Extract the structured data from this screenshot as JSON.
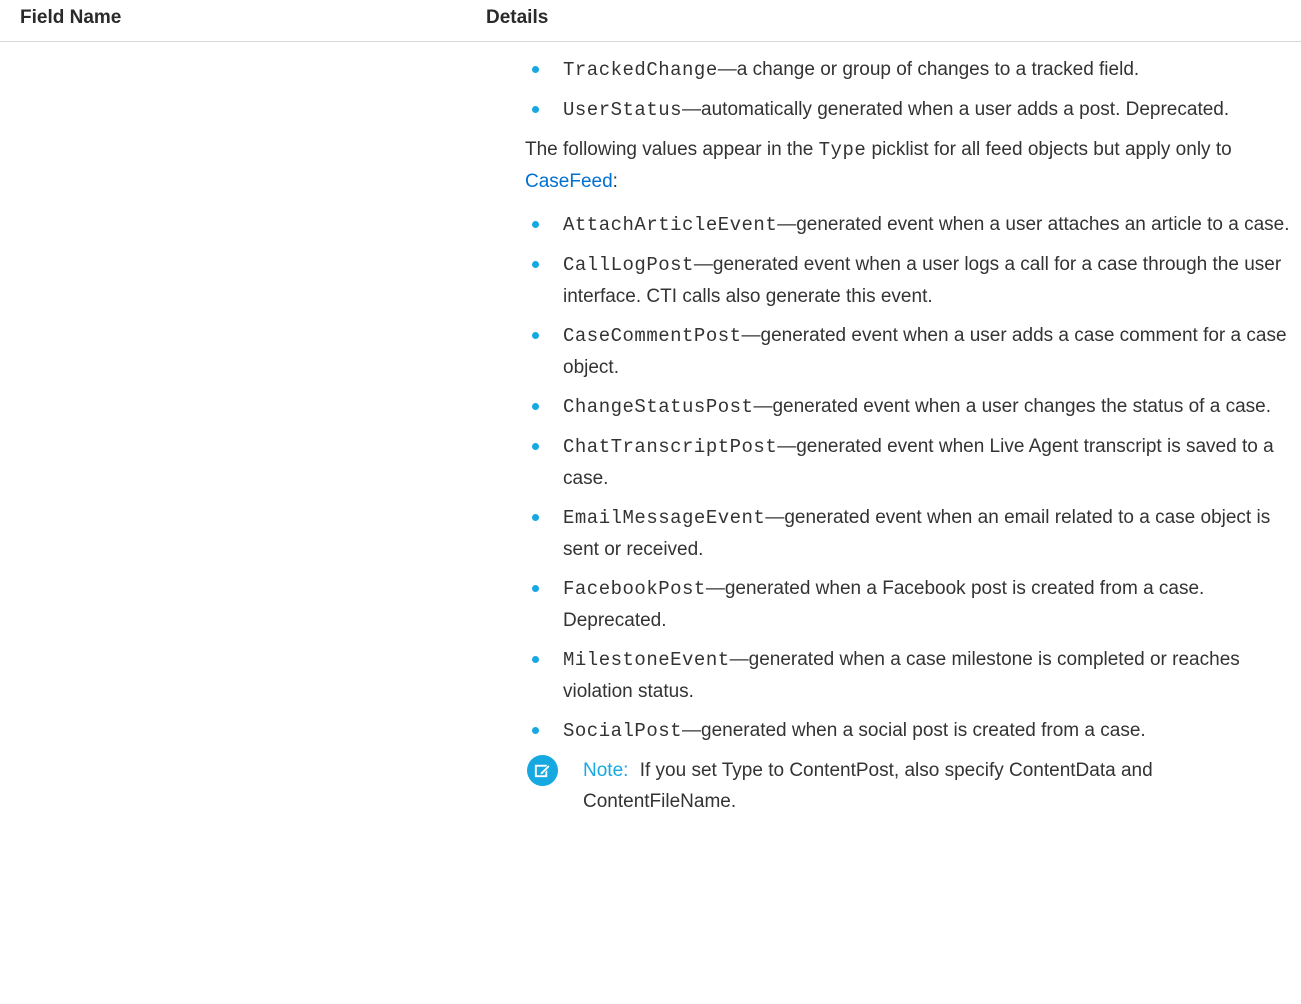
{
  "table": {
    "headers": [
      "Field Name",
      "Details"
    ]
  },
  "details": {
    "items_top": [
      {
        "code": "TrackedChange",
        "text": "—a change or group of changes to a tracked field."
      },
      {
        "code": "UserStatus",
        "text": "—automatically generated when a user adds a post. Deprecated."
      }
    ],
    "intro": {
      "before": "The following values appear in the ",
      "code": "Type",
      "middle": " picklist for all feed objects but apply only to ",
      "link": "CaseFeed",
      "after": ":"
    },
    "items_case": [
      {
        "code": "AttachArticleEvent",
        "text": "—generated event when a user attaches an article to a case."
      },
      {
        "code": "CallLogPost",
        "text": "—generated event when a user logs a call for a case through the user interface. CTI calls also generate this event."
      },
      {
        "code": "CaseCommentPost",
        "text": "—generated event when a user adds a case comment for a case object."
      },
      {
        "code": "ChangeStatusPost",
        "text": "—generated event when a user changes the status of a case."
      },
      {
        "code": "ChatTranscriptPost",
        "text": "—generated event when Live Agent transcript is saved to a case."
      },
      {
        "code": "EmailMessageEvent",
        "text": "—generated event when an email related to a case object is sent or received."
      },
      {
        "code": "FacebookPost",
        "text": "—generated when a Facebook post is created from a case. Deprecated."
      },
      {
        "code": "MilestoneEvent",
        "text": "—generated when a case milestone is completed or reaches violation status."
      },
      {
        "code": "SocialPost",
        "text": "—generated when a social post is created from a case."
      }
    ],
    "note": {
      "icon": "edit-note-icon",
      "label": "Note:",
      "text": "If you set Type to ContentPost, also specify ContentData and ContentFileName."
    },
    "colors": {
      "accent": "#16a8e1",
      "link": "#0070d2"
    }
  }
}
